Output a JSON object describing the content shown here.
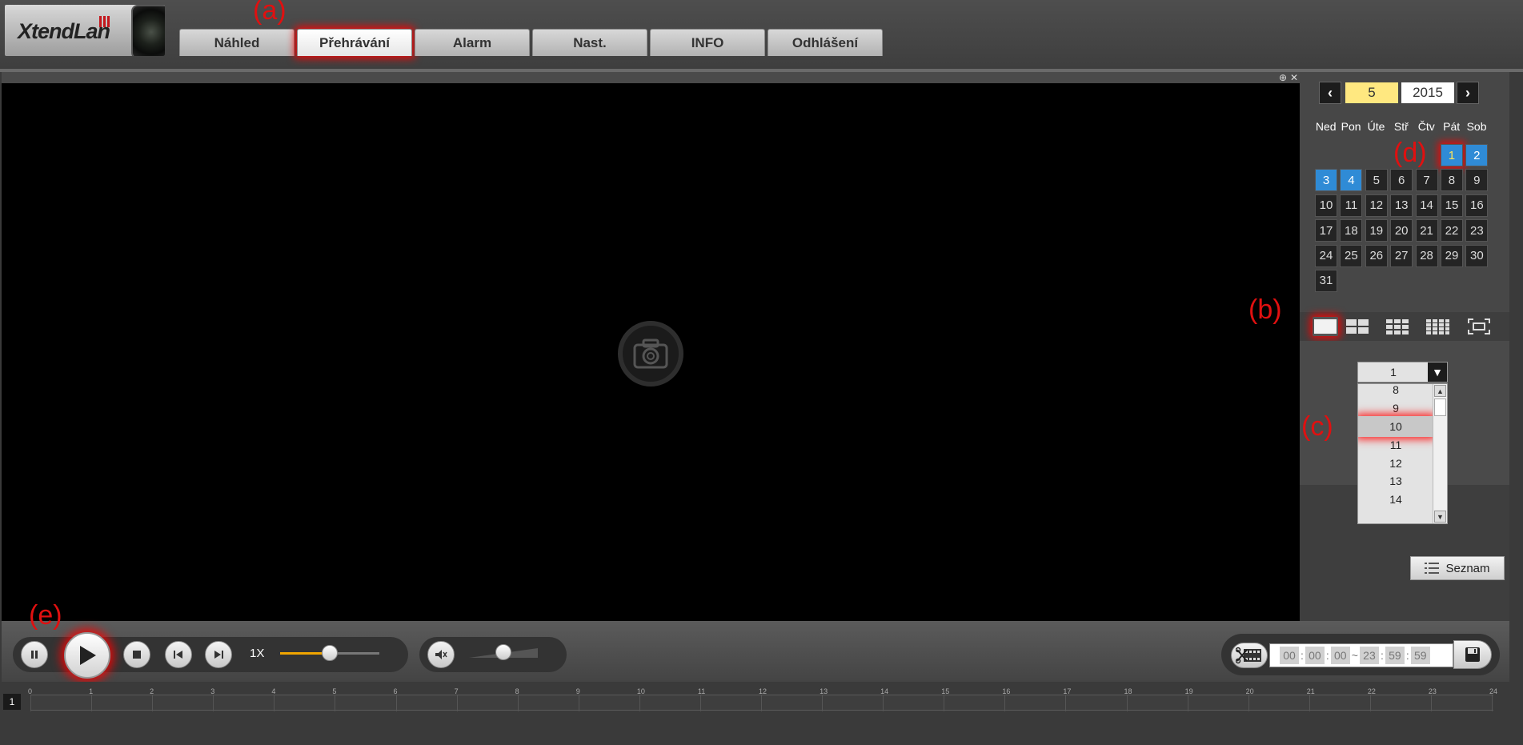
{
  "logo": {
    "text": "XtendLan"
  },
  "tabs": [
    {
      "label": "Náhled",
      "active": false
    },
    {
      "label": "Přehrávání",
      "active": true
    },
    {
      "label": "Alarm",
      "active": false
    },
    {
      "label": "Nast.",
      "active": false
    },
    {
      "label": "INFO",
      "active": false
    },
    {
      "label": "Odhlášení",
      "active": false
    }
  ],
  "annotations": {
    "a": "(a)",
    "b": "(b)",
    "c": "(c)",
    "d": "(d)",
    "e": "(e)"
  },
  "calendar": {
    "month": "5",
    "year": "2015",
    "weekdays": [
      "Ned",
      "Pon",
      "Úte",
      "Stř",
      "Čtv",
      "Pát",
      "Sob"
    ],
    "leading_blanks": 5,
    "days": [
      "1",
      "2",
      "3",
      "4",
      "5",
      "6",
      "7",
      "8",
      "9",
      "10",
      "11",
      "12",
      "13",
      "14",
      "15",
      "16",
      "17",
      "18",
      "19",
      "20",
      "21",
      "22",
      "23",
      "24",
      "25",
      "26",
      "27",
      "28",
      "29",
      "30",
      "31"
    ],
    "recorded_days": [
      "1",
      "2",
      "3",
      "4"
    ],
    "selected_day": "1"
  },
  "layouts": [
    "layout-1-icon",
    "layout-4-icon",
    "layout-9-icon",
    "layout-16-icon",
    "fullscreen-icon"
  ],
  "channel_dropdown": {
    "value": "1",
    "options": [
      "8",
      "9",
      "10",
      "11",
      "12",
      "13",
      "14"
    ],
    "highlighted": "10"
  },
  "list_button": "Seznam",
  "controls": {
    "speed": "1X",
    "speed_level": 0.5,
    "volume_level": 0.5
  },
  "time_range": {
    "start": [
      "00",
      "00",
      "00"
    ],
    "end": [
      "23",
      "59",
      "59"
    ],
    "separator": "~"
  },
  "timeline": {
    "channel": "1",
    "hours": [
      "0",
      "1",
      "2",
      "3",
      "4",
      "5",
      "6",
      "7",
      "8",
      "9",
      "10",
      "11",
      "12",
      "13",
      "14",
      "15",
      "16",
      "17",
      "18",
      "19",
      "20",
      "21",
      "22",
      "23",
      "24"
    ]
  },
  "colors": {
    "accent": "#2f8bd6",
    "highlight": "#ff0000",
    "speed": "#f0a500"
  }
}
